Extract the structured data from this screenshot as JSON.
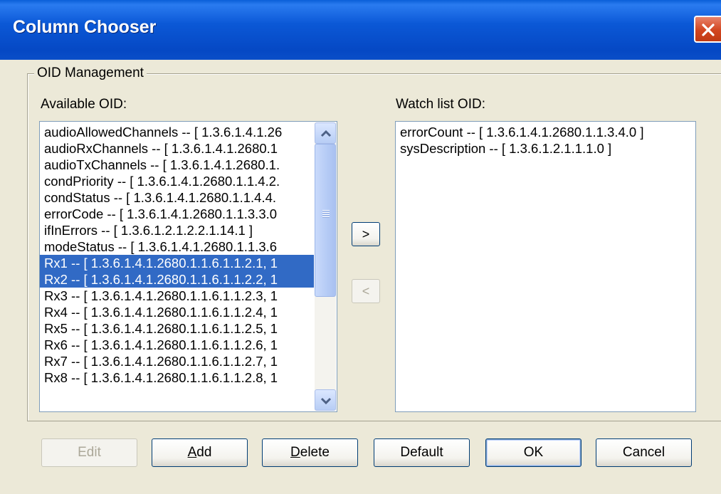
{
  "window": {
    "title": "Column Chooser"
  },
  "group": {
    "label": "OID Management"
  },
  "available": {
    "label": "Available OID:",
    "items": [
      {
        "text": "audioAllowedChannels -- [ 1.3.6.1.4.1.26",
        "selected": false
      },
      {
        "text": "audioRxChannels -- [ 1.3.6.1.4.1.2680.1",
        "selected": false
      },
      {
        "text": "audioTxChannels -- [ 1.3.6.1.4.1.2680.1.",
        "selected": false
      },
      {
        "text": "condPriority -- [ 1.3.6.1.4.1.2680.1.1.4.2.",
        "selected": false
      },
      {
        "text": "condStatus -- [ 1.3.6.1.4.1.2680.1.1.4.4.",
        "selected": false
      },
      {
        "text": "errorCode -- [ 1.3.6.1.4.1.2680.1.1.3.3.0",
        "selected": false
      },
      {
        "text": "ifInErrors -- [ 1.3.6.1.2.1.2.2.1.14.1 ]",
        "selected": false
      },
      {
        "text": "modeStatus -- [ 1.3.6.1.4.1.2680.1.1.3.6",
        "selected": false
      },
      {
        "text": "Rx1 -- [ 1.3.6.1.4.1.2680.1.1.6.1.1.2.1, 1",
        "selected": true
      },
      {
        "text": "Rx2 -- [ 1.3.6.1.4.1.2680.1.1.6.1.1.2.2, 1",
        "selected": true
      },
      {
        "text": "Rx3 -- [ 1.3.6.1.4.1.2680.1.1.6.1.1.2.3, 1",
        "selected": false
      },
      {
        "text": "Rx4 -- [ 1.3.6.1.4.1.2680.1.1.6.1.1.2.4, 1",
        "selected": false
      },
      {
        "text": "Rx5 -- [ 1.3.6.1.4.1.2680.1.1.6.1.1.2.5, 1",
        "selected": false
      },
      {
        "text": "Rx6 -- [ 1.3.6.1.4.1.2680.1.1.6.1.1.2.6, 1",
        "selected": false
      },
      {
        "text": "Rx7 -- [ 1.3.6.1.4.1.2680.1.1.6.1.1.2.7, 1",
        "selected": false
      },
      {
        "text": "Rx8 -- [ 1.3.6.1.4.1.2680.1.1.6.1.1.2.8, 1",
        "selected": false
      }
    ]
  },
  "watchlist": {
    "label": "Watch list OID:",
    "items": [
      {
        "text": "errorCount -- [ 1.3.6.1.4.1.2680.1.1.3.4.0 ]",
        "selected": false
      },
      {
        "text": "sysDescription -- [ 1.3.6.1.2.1.1.1.0 ]",
        "selected": false
      }
    ]
  },
  "transfer": {
    "add_symbol": ">",
    "remove_symbol": "<"
  },
  "buttons": {
    "edit": "Edit",
    "add": "Add",
    "delete": "Delete",
    "default": "Default",
    "ok": "OK",
    "cancel": "Cancel"
  },
  "colors": {
    "title_bar": "#0548c4",
    "selection": "#316ac5",
    "dialog_bg": "#ece9d8",
    "close_button": "#d2451f"
  },
  "icons": {
    "close": "close-x-icon",
    "scroll_up": "chevron-up-icon",
    "scroll_down": "chevron-down-icon",
    "thumb_grip": "grip-icon"
  }
}
